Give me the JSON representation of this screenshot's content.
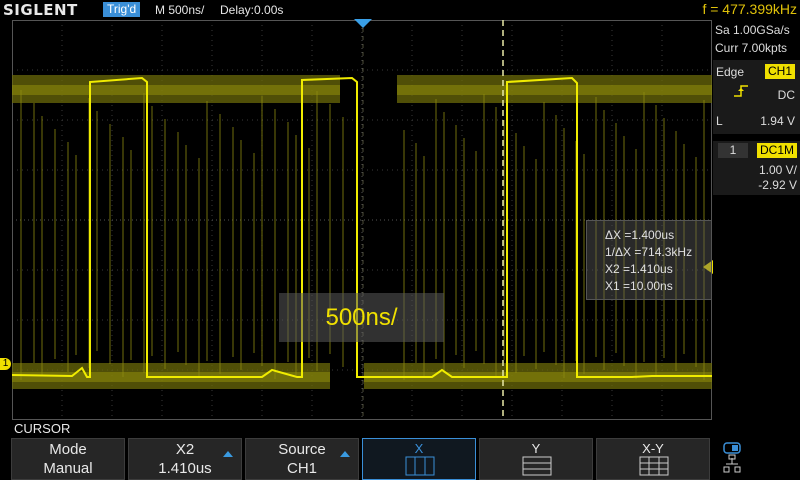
{
  "topbar": {
    "brand": "SIGLENT",
    "trig_state": "Trig'd",
    "timebase": "M 500ns/",
    "delay": "Delay:0.00s",
    "frequency": "f = 477.399kHz"
  },
  "acquisition": {
    "sample_rate": "Sa 1.00GSa/s",
    "memory": "Curr 7.00kpts"
  },
  "trigger": {
    "type": "Edge",
    "source": "CH1",
    "coupling": "DC",
    "level_label": "L",
    "level": "1.94 V"
  },
  "channel1": {
    "number": "1",
    "coupling": "DC1M",
    "scale": "1.00 V/",
    "offset": "-2.92 V",
    "marker": "1"
  },
  "cursor_info": {
    "dx": "ΔX =1.400us",
    "inv_dx": "1/ΔX =714.3kHz",
    "x2": "X2 =1.410us",
    "x1": "X1 =10.00ns"
  },
  "timebase_popup": "500ns/",
  "menu": {
    "title": "CURSOR",
    "keys": [
      {
        "line1": "Mode",
        "line2": "Manual"
      },
      {
        "line1": "X2",
        "line2": "1.410us"
      },
      {
        "line1": "Source",
        "line2": "CH1"
      },
      {
        "line1": "X",
        "line2": ""
      },
      {
        "line1": "Y",
        "line2": ""
      },
      {
        "line1": "X-Y",
        "line2": ""
      }
    ]
  },
  "colors": {
    "trace": "#e6e000",
    "accent": "#3a8fd8",
    "cursor": "#e8e8b0"
  },
  "icons": {
    "trigger_edge": "rising-edge-icon",
    "trigger_pointer": "triangle-down-icon",
    "network": "network-icon"
  }
}
